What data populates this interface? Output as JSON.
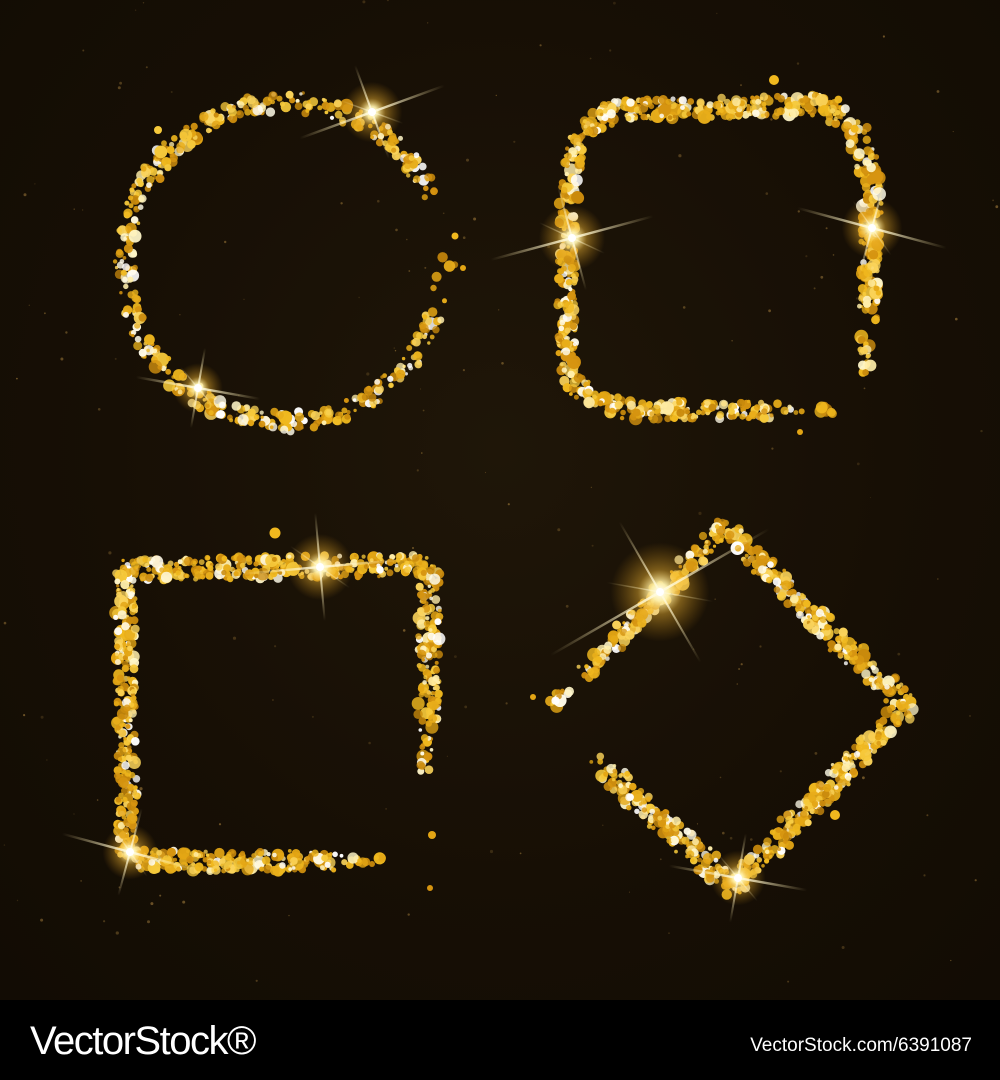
{
  "image": {
    "subject": "Gold glitter frames on dark background",
    "frames": [
      {
        "shape": "circle"
      },
      {
        "shape": "rounded-square"
      },
      {
        "shape": "square"
      },
      {
        "shape": "rhombus"
      }
    ],
    "colors": {
      "background": "#150e05",
      "glitter_gold": "#e3a514",
      "glitter_light": "#fff6c8",
      "sparkle": "#fffbe6"
    }
  },
  "watermark": {
    "brand": "VectorStock®",
    "image_id": "VectorStock.com/6391087"
  }
}
